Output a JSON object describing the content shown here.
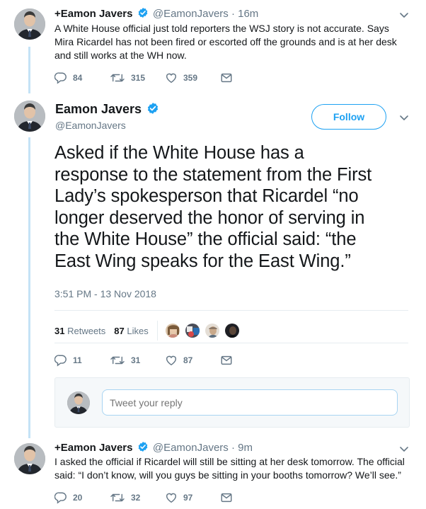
{
  "colors": {
    "blue": "#1da1f2",
    "gray": "#657786",
    "thread": "#c4e3f6"
  },
  "tweet1": {
    "plus": "+",
    "name": "Eamon Javers",
    "handle": "@EamonJavers",
    "sep": "·",
    "time": "16m",
    "text_lines": [
      "A White House official just told reporters the WSJ story is not accurate. Says",
      "Mira Ricardel has not been fired or escorted off the grounds and is at her desk",
      "and still works at the WH now."
    ],
    "replies": "84",
    "retweets": "315",
    "likes": "359"
  },
  "main": {
    "name": "Eamon Javers",
    "handle": "@EamonJavers",
    "follow_label": "Follow",
    "text_lines": [
      "Asked if the White House has a",
      "response to the statement from the First",
      "Lady’s spokesperson that Ricardel “no",
      "longer deserved the honor of serving in",
      "the White House” the official said: “the",
      "East Wing speaks for the East Wing.”"
    ],
    "timestamp": "3:51 PM - 13 Nov 2018",
    "retweet_count": "31",
    "retweet_label": "Retweets",
    "like_count": "87",
    "like_label": "Likes",
    "replies": "11",
    "retweets": "31",
    "likes": "87"
  },
  "reply": {
    "placeholder": "Tweet your reply"
  },
  "tweet3": {
    "plus": "+",
    "name": "Eamon Javers",
    "handle": "@EamonJavers",
    "sep": "·",
    "time": "9m",
    "text_lines": [
      "I asked the official if Ricardel will still be sitting at her desk tomorrow. The official",
      "said: “I don’t know, will you guys be sitting in your booths tomorrow? We’ll see.”"
    ],
    "replies": "20",
    "retweets": "32",
    "likes": "97"
  }
}
